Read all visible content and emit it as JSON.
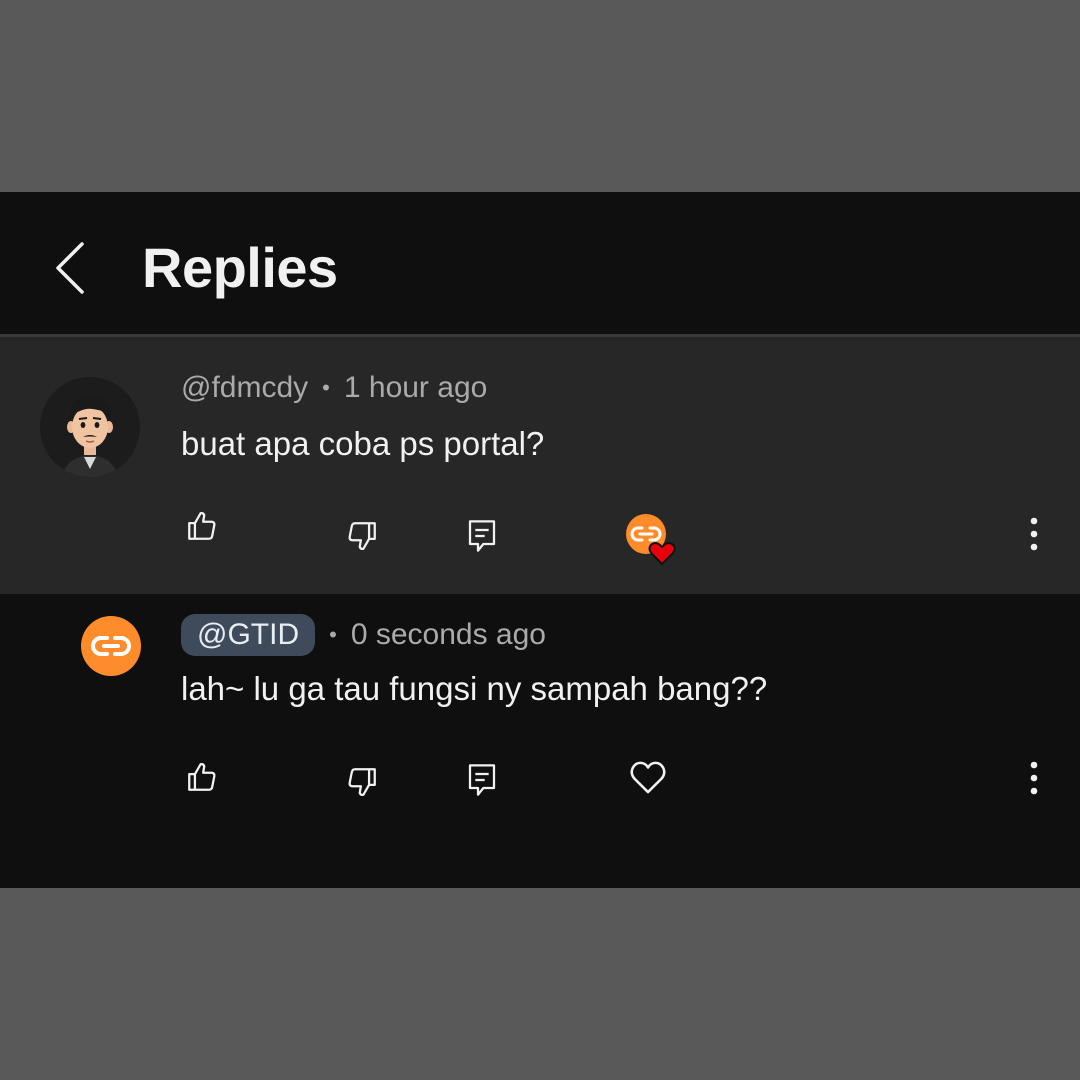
{
  "header": {
    "title": "Replies",
    "back_icon": "chevron-left-icon"
  },
  "parent_comment": {
    "avatar_icon": "cartoon-avatar-icon",
    "handle": "@fdmcdy",
    "separator": "•",
    "time": "1 hour ago",
    "text": "buat apa coba ps portal?",
    "creator_heart": true
  },
  "reply_comment": {
    "avatar_icon": "link-avatar-icon",
    "handle": "@GTID",
    "separator": "•",
    "time": "0 seconds ago",
    "text": "lah~ lu ga tau fungsi ny sampah bang??"
  },
  "actions": [
    "like-icon",
    "dislike-icon",
    "reply-icon",
    "heart-icon",
    "more-vert-icon"
  ],
  "colors": {
    "page_bg": "#595959",
    "app_bg": "#0f0f0f",
    "parent_bg": "#272727",
    "accent_orange": "#ff8c2b",
    "heart_red": "#e8000b",
    "chip_bg": "#3f4a5a"
  }
}
